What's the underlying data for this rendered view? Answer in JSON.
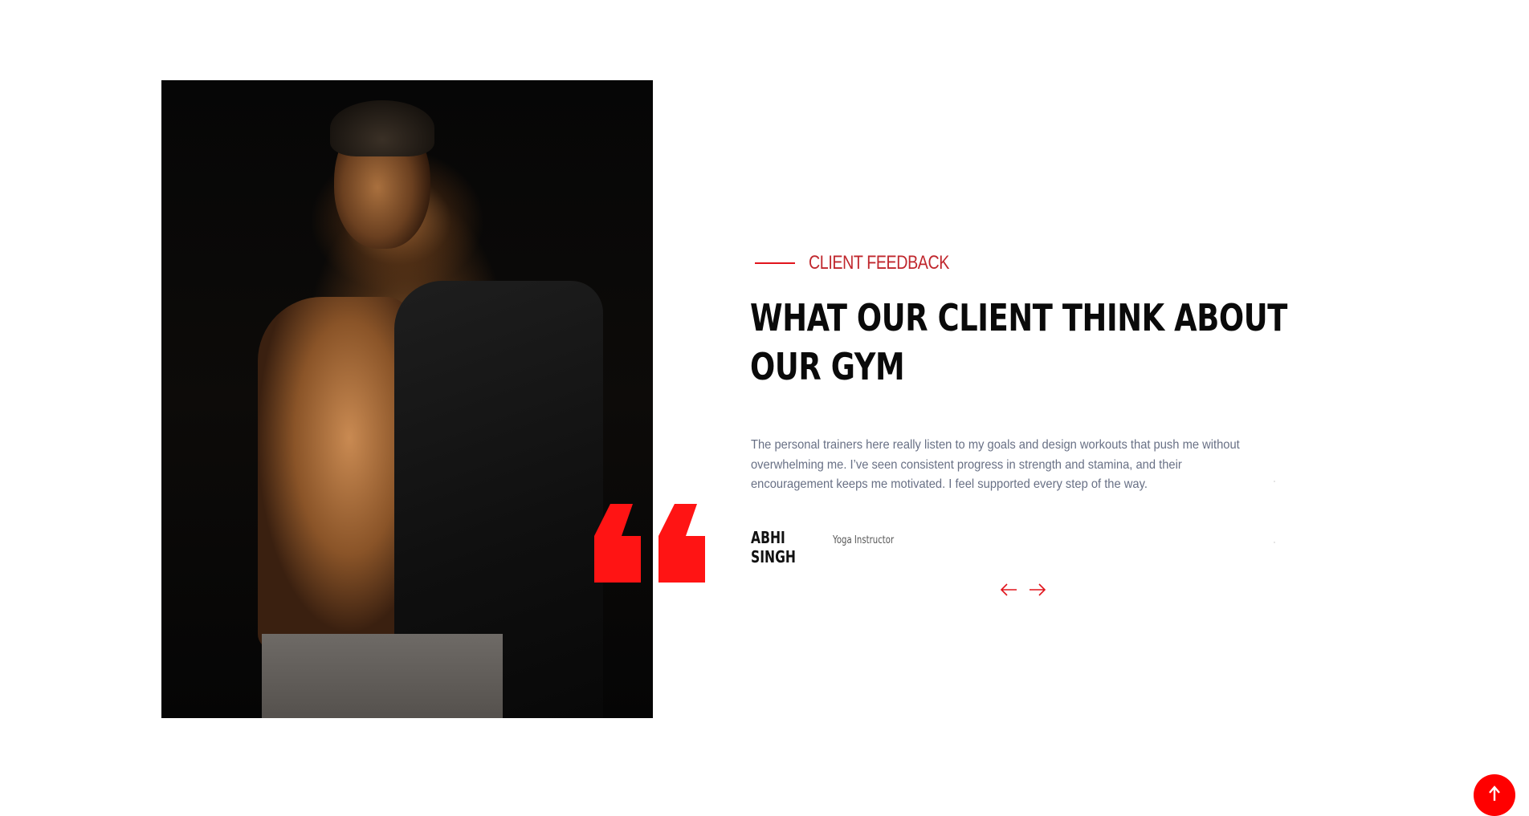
{
  "section": {
    "eyebrow": "CLIENT FEEDBACK",
    "heading_line1": "WHAT OUR CLIENT THINK ABOUT",
    "heading_line2": "OUR GYM"
  },
  "testimonial": {
    "text": "The personal trainers here really listen to my goals and design workouts that push me without overwhelming me. I’ve seen consistent progress in strength and stamina, and their encouragement keeps me motivated. I feel supported every step of the way.",
    "author_name": "ABHI SINGH",
    "author_role": "Yoga Instructor"
  },
  "icons": {
    "quote": "quote-icon",
    "prev": "arrow-left-icon",
    "next": "arrow-right-icon",
    "scroll_top": "arrow-up-icon"
  },
  "colors": {
    "accent": "#e1141c",
    "heading": "#0a0a0a",
    "body_text": "#687085",
    "scroll_button": "#ff0000"
  }
}
